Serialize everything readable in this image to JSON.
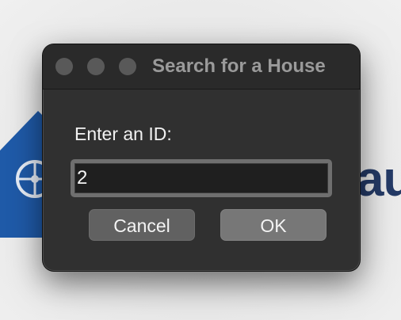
{
  "window": {
    "title": "Search for a House"
  },
  "dialog": {
    "prompt": "Enter an ID:",
    "input_value": "2",
    "cancel_label": "Cancel",
    "ok_label": "OK"
  },
  "background": {
    "app_text_fragment": "au",
    "logo_icon": "house-logo-icon"
  },
  "colors": {
    "dialog_bg": "#303030",
    "titlebar_bg": "#2a2a2a",
    "traffic_light": "#595959",
    "brand_blue": "#1f5aa8",
    "brand_navy": "#243a66"
  }
}
